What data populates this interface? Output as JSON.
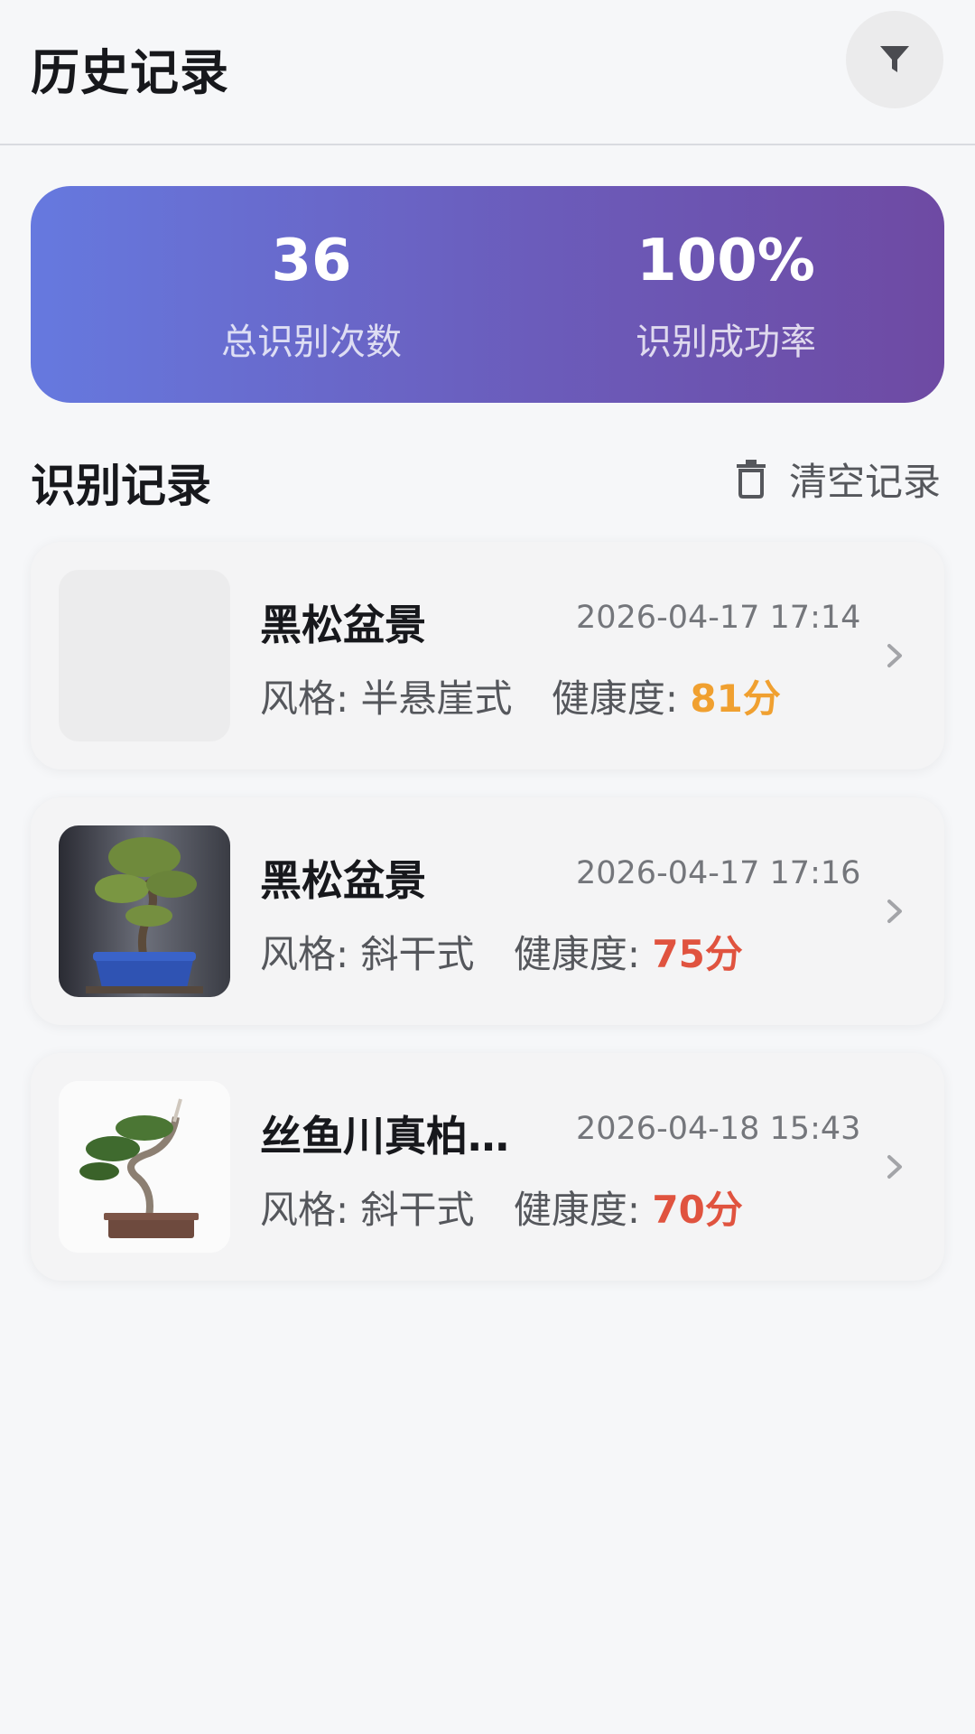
{
  "header": {
    "title": "历史记录",
    "filter_icon": "filter-icon"
  },
  "stats": {
    "total_value": "36",
    "total_label": "总识别次数",
    "rate_value": "100%",
    "rate_label": "识别成功率",
    "gradient": [
      "#6679df",
      "#6e4aa3"
    ]
  },
  "section": {
    "title": "识别记录",
    "clear_label": "清空记录",
    "clear_icon": "trash-icon"
  },
  "records": [
    {
      "name": "黑松盆景",
      "time": "2026-04-17 17:14",
      "style_label": "风格:",
      "style": "半悬崖式",
      "health_label": "健康度:",
      "score": "81分",
      "score_color": "#f0a030"
    },
    {
      "name": "黑松盆景",
      "time": "2026-04-17 17:16",
      "style_label": "风格:",
      "style": "斜干式",
      "health_label": "健康度:",
      "score": "75分",
      "score_color": "#e0533f"
    },
    {
      "name": "丝鱼川真柏…",
      "time": "2026-04-18 15:43",
      "style_label": "风格:",
      "style": "斜干式",
      "health_label": "健康度:",
      "score": "70分",
      "score_color": "#e0533f"
    }
  ]
}
